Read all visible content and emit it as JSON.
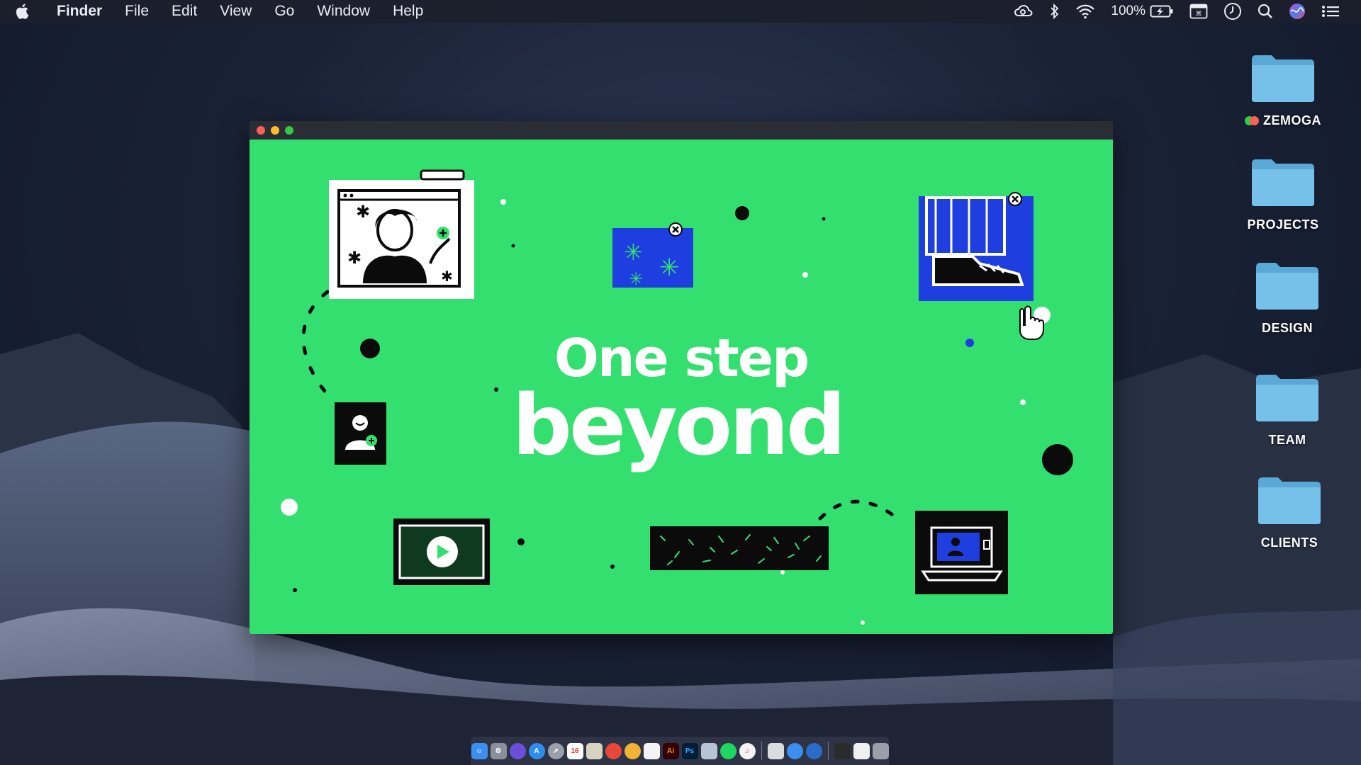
{
  "menubar": {
    "app_name": "Finder",
    "items": [
      "File",
      "Edit",
      "View",
      "Go",
      "Window",
      "Help"
    ],
    "battery": "100%",
    "status_icons": [
      "creative-cloud-icon",
      "bluetooth-icon",
      "wifi-icon",
      "battery-charging-icon",
      "keyboard-shortcut-icon",
      "clock-icon",
      "spotlight-search-icon",
      "siri-icon",
      "notification-center-icon"
    ]
  },
  "window": {
    "headline_line1": "One step",
    "headline_line2": "beyond",
    "background_color": "#33e06f"
  },
  "desktop": {
    "folders": [
      {
        "label": "ZEMOGA",
        "tag_colors": [
          "#35c849",
          "#fb5f57"
        ]
      },
      {
        "label": "PROJECTS"
      },
      {
        "label": "DESIGN"
      },
      {
        "label": "TEAM"
      },
      {
        "label": "CLIENTS"
      }
    ]
  },
  "dock": {
    "apps": [
      "finder-icon",
      "system-preferences-icon",
      "siri-icon",
      "app-store-icon",
      "launchpad-icon",
      "calendar-icon",
      "notes-icon",
      "chrome-icon",
      "photos-icon",
      "text-edit-icon",
      "illustrator-icon",
      "photoshop-icon",
      "preview-icon",
      "spotify-icon",
      "itunes-icon",
      "books-icon",
      "safari-icon",
      "network-icon",
      "terminal-icon",
      "display-icon",
      "trash-icon"
    ],
    "illustrator_label": "Ai",
    "photoshop_label": "Ps"
  },
  "colors": {
    "accent_green": "#33e06f",
    "illustration_blue": "#1f3ee0",
    "menubar": "#1c202c"
  }
}
